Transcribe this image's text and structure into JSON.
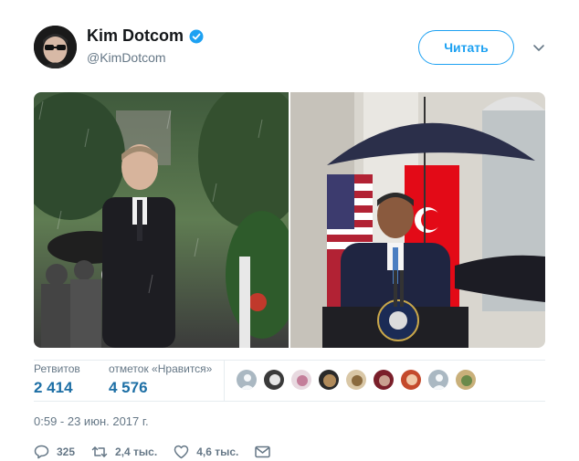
{
  "tweet": {
    "author": {
      "display_name": "Kim Dotcom",
      "handle": "@KimDotcom",
      "verified": true,
      "avatar_icon": "avatar-image"
    },
    "follow_label": "Читать",
    "menu_icon": "chevron-down-icon",
    "media": [
      {
        "icon": "photo-left"
      },
      {
        "icon": "photo-right"
      }
    ],
    "stats": {
      "retweets_label": "Ретвитов",
      "retweets_value": "2 414",
      "likes_label": "отметок «Нравится»",
      "likes_value": "4 576"
    },
    "timestamp": "0:59 - 23 июн. 2017 г.",
    "actions": {
      "reply_count": "325",
      "retweet_count": "2,4 тыс.",
      "like_count": "4,6 тыс."
    }
  },
  "colors": {
    "accent": "#1da1f2",
    "stat_value": "#1d6fa5",
    "secondary_text": "#657786",
    "verified": "#1da1f2"
  }
}
